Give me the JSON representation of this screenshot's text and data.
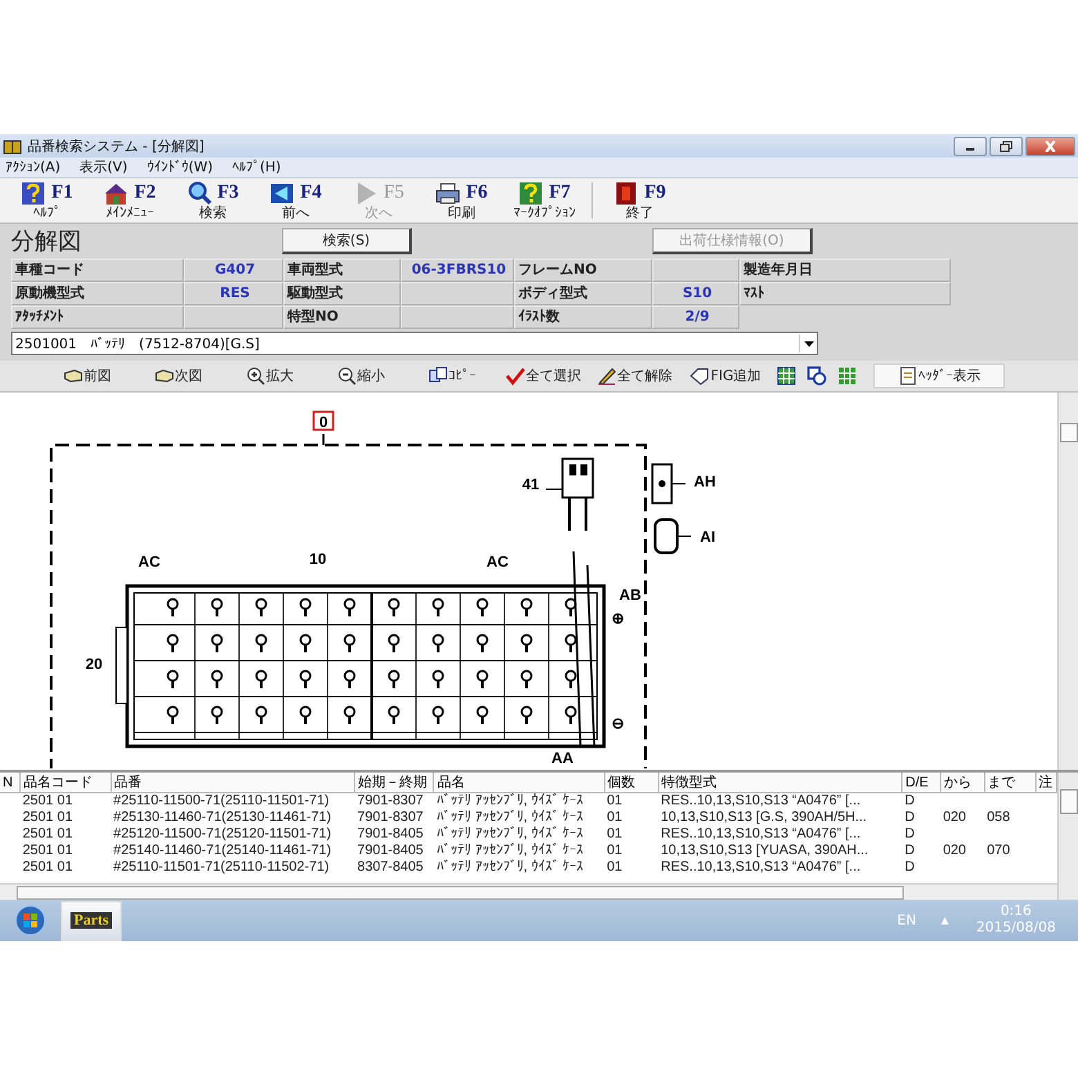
{
  "window": {
    "title": "品番検索システム - [分解図]"
  },
  "menu": [
    "ｱｸｼｮﾝ(A)",
    "表示(V)",
    "ｳｲﾝﾄﾞｳ(W)",
    "ﾍﾙﾌﾟ(H)"
  ],
  "toolbar": [
    {
      "key": "F1",
      "label": "ﾍﾙﾌﾟ",
      "disabled": false
    },
    {
      "key": "F2",
      "label": "ﾒｲﾝﾒﾆｭｰ",
      "disabled": false
    },
    {
      "key": "F3",
      "label": "検索",
      "disabled": false
    },
    {
      "key": "F4",
      "label": "前へ",
      "disabled": false
    },
    {
      "key": "F5",
      "label": "次へ",
      "disabled": true
    },
    {
      "key": "F6",
      "label": "印刷",
      "disabled": false
    },
    {
      "key": "F7",
      "label": "ﾏｰｸｵﾌﾟｼｮﾝ",
      "disabled": false
    },
    {
      "key": "F9",
      "label": "終了",
      "disabled": false
    }
  ],
  "header": {
    "title": "分解図",
    "search_button": {
      "label": "検索(S)",
      "disabled": false
    },
    "shipping_button": {
      "label": "出荷仕様情報(O)",
      "disabled": true
    }
  },
  "fields": [
    [
      {
        "label": "車種コード",
        "value": "G407"
      },
      {
        "label": "車両型式",
        "value": "06-3FBRS10"
      },
      {
        "label": "フレームNO"
      },
      {
        "label": "製造年月日"
      }
    ],
    [
      {
        "label": "原動機型式",
        "value": "RES"
      },
      {
        "label": "駆動型式"
      },
      {
        "label": "ボディ型式",
        "value": "S10"
      },
      {
        "label": "ﾏｽﾄ"
      }
    ],
    [
      {
        "label": "ｱﾀｯﾁﾒﾝﾄ"
      },
      {
        "label": "特型NO"
      },
      {
        "label": "ｲﾗｽﾄ数",
        "value": "2/9"
      }
    ]
  ],
  "part_select": {
    "value": "2501001　ﾊﾞｯﾃﾘ　(7512-8704)[G.S]"
  },
  "view_toolbar": [
    {
      "label": "前図",
      "pressed": false
    },
    {
      "label": "次図",
      "pressed": false
    },
    {
      "label": "拡大",
      "pressed": false
    },
    {
      "label": "縮小",
      "pressed": false
    },
    {
      "label": "ｺﾋﾟｰ",
      "pressed": false
    },
    {
      "label": "全て選択",
      "pressed": false
    },
    {
      "label": "全て解除",
      "pressed": false
    },
    {
      "label": "FIG追加",
      "pressed": false
    },
    {
      "pressed": false
    },
    {
      "pressed": false
    },
    {
      "pressed": false
    },
    {
      "label": "ﾍｯﾀﾞｰ表示",
      "pressed": true
    }
  ],
  "diagram": {
    "callouts": [
      "0",
      "41",
      "AH",
      "AI",
      "AC",
      "10",
      "AC",
      "AB",
      "20",
      "AA",
      "⊕",
      "⊖"
    ]
  },
  "parts_table": {
    "columns": [
      "N",
      "品名コード",
      "品番",
      "始期－終期",
      "品名",
      "個数",
      "特徴型式",
      "D/E",
      "から",
      "まで",
      "注"
    ],
    "rows": [
      [
        "",
        "2501 01",
        "#25110-11500-71(25110-11501-71)",
        "7901-8307",
        "ﾊﾞｯﾃﾘ ｱｯｾﾝﾌﾞﾘ, ｳｲｽﾞ ｹｰｽ",
        "01",
        "RES..10,13,S10,S13 “A0476” [...",
        "D",
        "",
        "",
        ""
      ],
      [
        "",
        "2501 01",
        "#25130-11460-71(25130-11461-71)",
        "7901-8307",
        "ﾊﾞｯﾃﾘ ｱｯｾﾝﾌﾞﾘ, ｳｲｽﾞ ｹｰｽ",
        "01",
        "10,13,S10,S13 [G.S, 390AH/5H...",
        "D",
        "020",
        "058",
        ""
      ],
      [
        "",
        "2501 01",
        "#25120-11500-71(25120-11501-71)",
        "7901-8405",
        "ﾊﾞｯﾃﾘ ｱｯｾﾝﾌﾞﾘ, ｳｲｽﾞ ｹｰｽ",
        "01",
        "RES..10,13,S10,S13 “A0476” [...",
        "D",
        "",
        "",
        ""
      ],
      [
        "",
        "2501 01",
        "#25140-11460-71(25140-11461-71)",
        "7901-8405",
        "ﾊﾞｯﾃﾘ ｱｯｾﾝﾌﾞﾘ, ｳｲｽﾞ ｹｰｽ",
        "01",
        "10,13,S10,S13 [YUASA, 390AH...",
        "D",
        "020",
        "070",
        ""
      ],
      [
        "",
        "2501 01",
        "#25110-11501-71(25110-11502-71)",
        "8307-8405",
        "ﾊﾞｯﾃﾘ ｱｯｾﾝﾌﾞﾘ, ｳｲｽﾞ ｹｰｽ",
        "01",
        "RES..10,13,S10,S13 “A0476” [...",
        "D",
        "",
        "",
        ""
      ]
    ]
  },
  "taskbar": {
    "app_label": "Parts",
    "language": "EN",
    "tray_arrow": "▲",
    "time": "0:16",
    "date": "2015/08/08"
  }
}
